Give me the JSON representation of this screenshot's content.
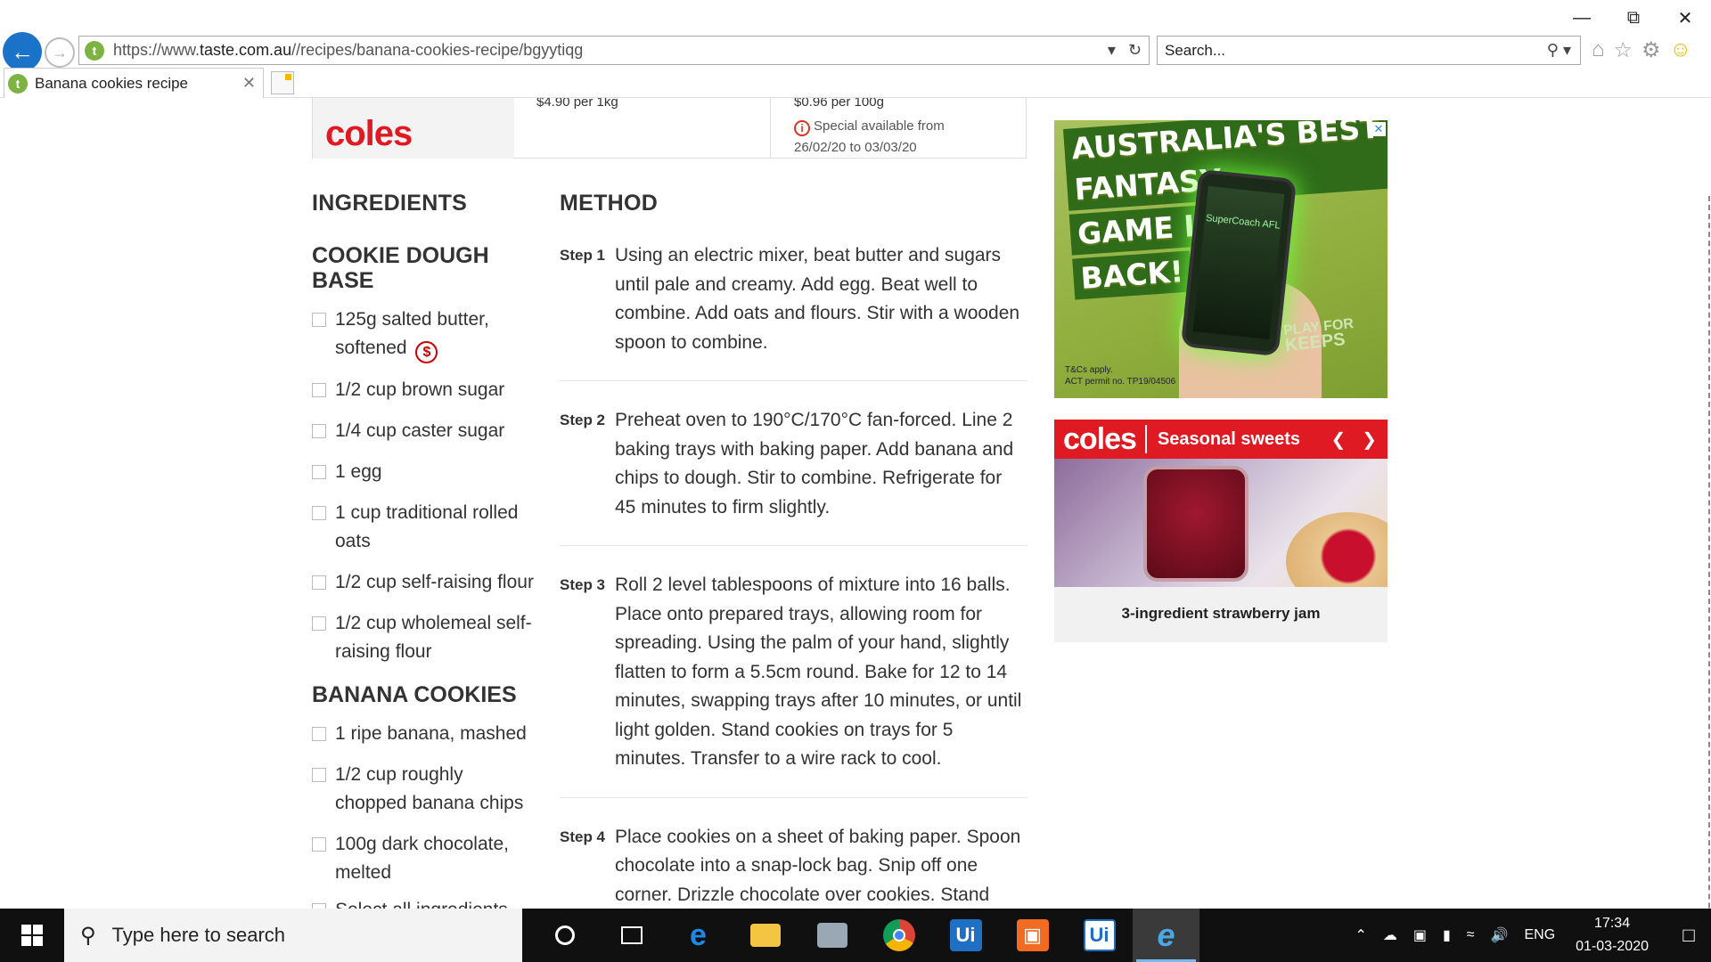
{
  "browser": {
    "url_prefix": "https://www.",
    "url_domain": "taste.com.au",
    "url_path": "//recipes/banana-cookies-recipe/bgyytiqg",
    "search_placeholder": "Search...",
    "tab_title": "Banana cookies recipe",
    "site_icon_letter": "t"
  },
  "price_card": {
    "brand": "coles",
    "price_per_kg": "$4.90 per 1kg",
    "price_per_100g": "$0.96 per 100g",
    "special_line1": "Special available from",
    "special_line2": "26/02/20 to 03/03/20"
  },
  "ingredients": {
    "heading": "INGREDIENTS",
    "group1_title": "COOKIE DOUGH BASE",
    "group1_items": [
      "125g salted butter, softened",
      "1/2 cup brown sugar",
      "1/4 cup caster sugar",
      "1 egg",
      "1 cup traditional rolled oats",
      "1/2 cup self-raising flour",
      "1/2 cup wholemeal self-raising flour"
    ],
    "group2_title": "BANANA COOKIES",
    "group2_items": [
      "1 ripe banana, mashed",
      "1/2 cup roughly chopped banana chips",
      "100g dark chocolate, melted"
    ],
    "select_all": "Select all ingredients"
  },
  "method": {
    "heading": "METHOD",
    "steps": [
      {
        "label": "Step 1",
        "text": "Using an electric mixer, beat butter and sugars until pale and creamy. Add egg. Beat well to combine. Add oats and flours. Stir with a wooden spoon to combine."
      },
      {
        "label": "Step 2",
        "text": "Preheat oven to 190°C/170°C fan-forced. Line 2 baking trays with baking paper. Add banana and chips to dough. Stir to combine. Refrigerate for 45 minutes to firm slightly."
      },
      {
        "label": "Step 3",
        "text": "Roll 2 level tablespoons of mixture into 16 balls. Place onto prepared trays, allowing room for spreading. Using the palm of your hand, slightly flatten to form a 5.5cm round. Bake for 12 to 14 minutes, swapping trays after 10 minutes, or until light golden. Stand cookies on trays for 5 minutes. Transfer to a wire rack to cool."
      },
      {
        "label": "Step 4",
        "text": "Place cookies on a sheet of baking paper. Spoon chocolate into a snap-lock bag. Snip off one corner. Drizzle chocolate over cookies. Stand until"
      }
    ]
  },
  "ad_kfc": {
    "line1": "AUSTRALIA'S BEST FANTASY",
    "line2": "GAME IS",
    "line3": "BACK!",
    "phone_label": "SuperCoach AFL",
    "play_for": "PLAY FOR",
    "keeps": "KEEPS",
    "fine1": "T&Cs apply.",
    "fine2": "ACT permit no. TP19/04506"
  },
  "ad_coles": {
    "brand": "coles",
    "title": "Seasonal sweets",
    "caption": "3-ingredient strawberry jam"
  },
  "taskbar": {
    "search_placeholder": "Type here to search",
    "language": "ENG",
    "time": "17:34",
    "date": "01-03-2020"
  },
  "colors": {
    "coles_red": "#e01a22",
    "ie_blue": "#1a73c8",
    "taste_green": "#7cb342"
  }
}
